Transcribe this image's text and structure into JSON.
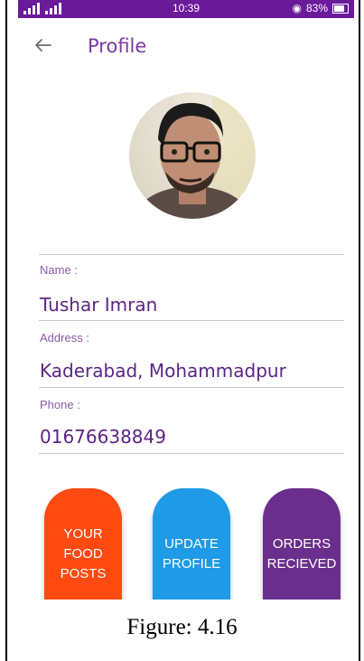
{
  "statusbar": {
    "time": "10:39",
    "battery": "83%"
  },
  "header": {
    "title": "Profile",
    "back_icon": "arrow-left-icon"
  },
  "avatar": {
    "alt": "profile photo"
  },
  "fields": [
    {
      "label": "Name :",
      "value": "Tushar Imran"
    },
    {
      "label": "Address :",
      "value": "Kaderabad, Mohammadpur"
    },
    {
      "label": "Phone :",
      "value": "01676638849"
    }
  ],
  "actions": [
    {
      "label": "YOUR FOOD\nPOSTS",
      "color": "#ff4a12"
    },
    {
      "label": "UPDATE\nPROFILE",
      "color": "#1e9ae6"
    },
    {
      "label": "ORDERS\nRECIEVED",
      "color": "#6a2f8c"
    }
  ],
  "caption": "Figure: 4.16",
  "colors": {
    "accent": "#6a1b9a",
    "title": "#7b3aa0"
  }
}
